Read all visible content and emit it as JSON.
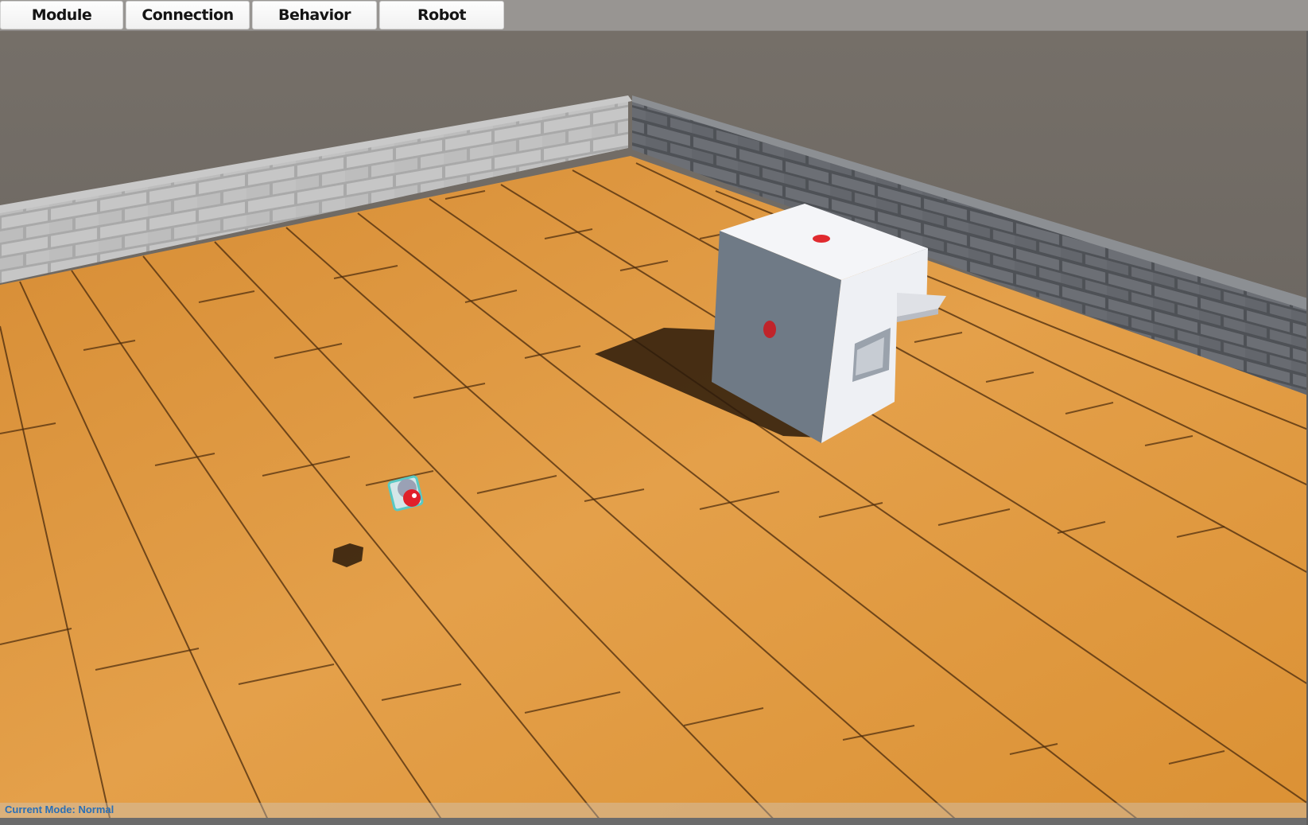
{
  "menu": {
    "module_label": "Module",
    "connection_label": "Connection",
    "behavior_label": "Behavior",
    "robot_label": "Robot"
  },
  "status": {
    "mode_text": "Current Mode: Normal"
  },
  "scene": {
    "objects": [
      "brick-wall-left",
      "brick-wall-right",
      "wooden-floor",
      "white-robot-module",
      "small-module"
    ],
    "colors": {
      "sky": "#6a645f",
      "floor": "#e09a3c",
      "wall": "#a9a9a9",
      "module": "#eef0f4",
      "connector": "#e02a2f",
      "status_text": "#2a6fb6"
    }
  }
}
